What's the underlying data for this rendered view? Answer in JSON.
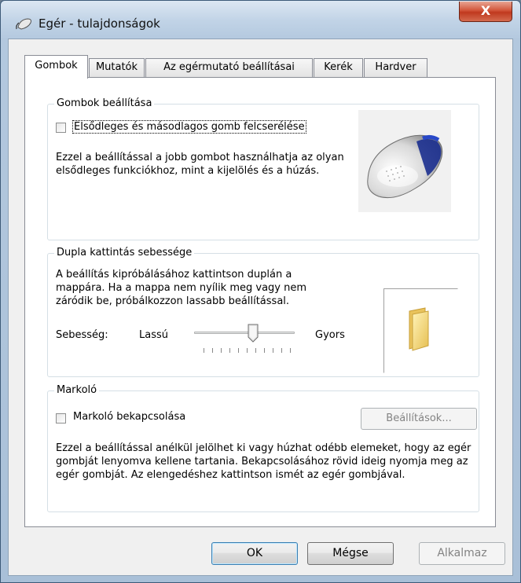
{
  "window": {
    "title": "Egér - tulajdonságok",
    "close_label": "X"
  },
  "tabs": [
    {
      "label": "Gombok",
      "active": true
    },
    {
      "label": "Mutatók",
      "active": false
    },
    {
      "label": "Az egérmutató beállításai",
      "active": false
    },
    {
      "label": "Kerék",
      "active": false
    },
    {
      "label": "Hardver",
      "active": false
    }
  ],
  "buttons_group": {
    "title": "Gombok beállítása",
    "checkbox_label": "Elsődleges és másodlagos gomb felcserélése",
    "checked": false,
    "description": "Ezzel a beállítással a jobb gombot használhatja az olyan elsődleges funkciókhoz, mint a kijelölés és a húzás."
  },
  "double_click_group": {
    "title": "Dupla kattintás sebessége",
    "description": "A beállítás kipróbálásához kattintson duplán a mappára. Ha a mappa nem nyílik meg vagy nem záródik be, próbálkozzon lassabb beállítással.",
    "speed_label": "Sebesség:",
    "slow_label": "Lassú",
    "fast_label": "Gyors",
    "slider_value_fraction": 0.6
  },
  "clicklock_group": {
    "title": "Markoló",
    "checkbox_label": "Markoló bekapcsolása",
    "checked": false,
    "settings_button": "Beállítások...",
    "description": "Ezzel a beállítással anélkül jelölhet ki vagy húzhat odébb elemeket, hogy az egér gombját lenyomva kellene tartania. Bekapcsolásához rövid ideig nyomja meg az egér gombját. Az elengedéshez kattintson ismét az egér gombjával."
  },
  "footer": {
    "ok": "OK",
    "cancel": "Mégse",
    "apply": "Alkalmaz"
  }
}
